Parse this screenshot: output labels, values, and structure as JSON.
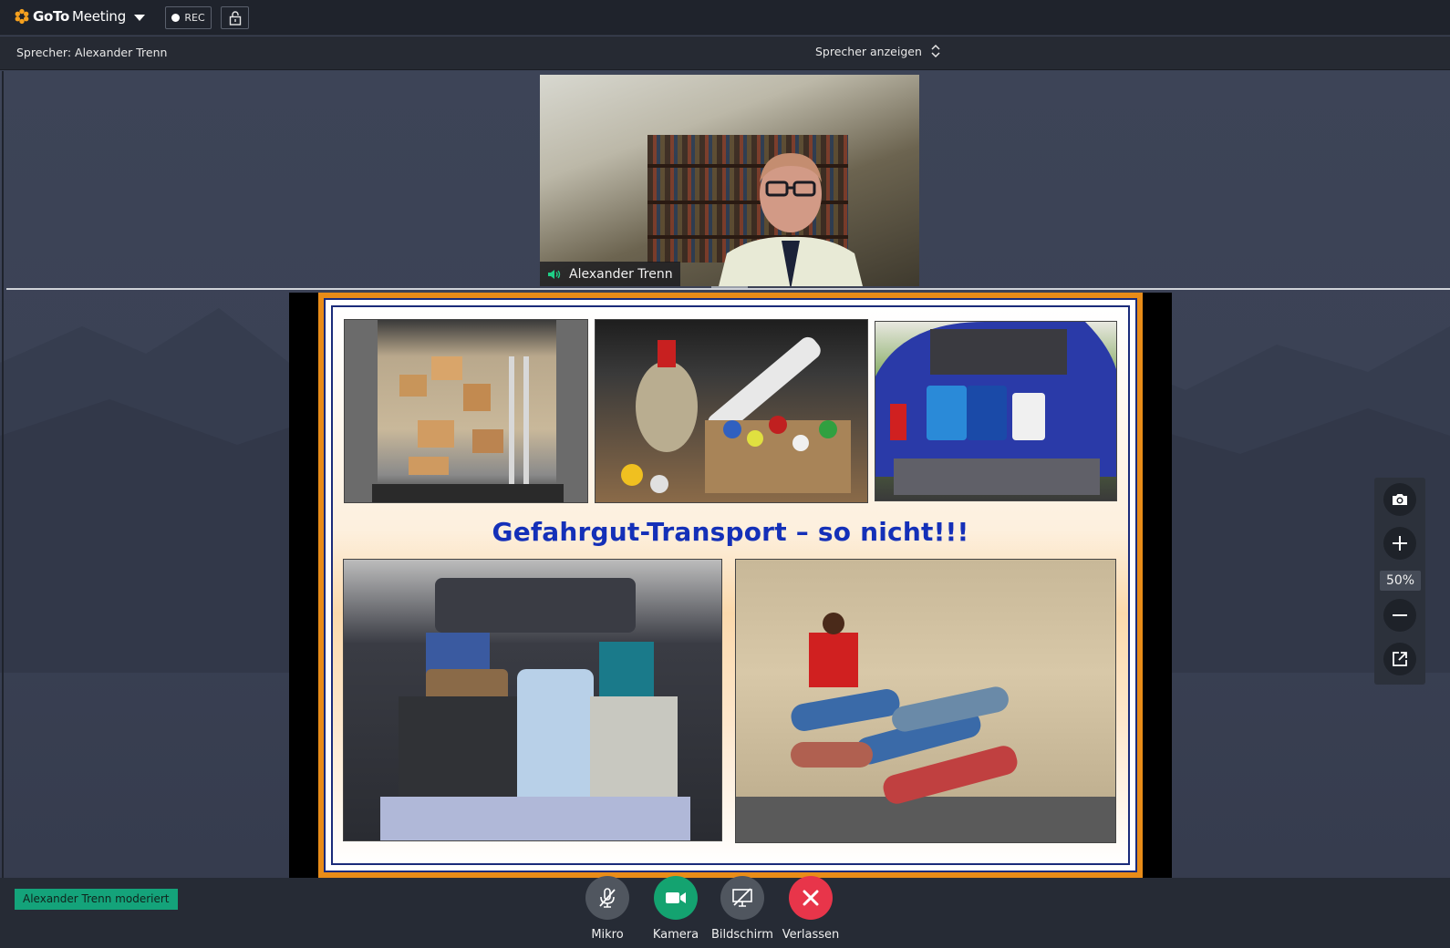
{
  "app": {
    "logo_goto": "GoTo",
    "logo_meeting": "Meeting",
    "rec_label": "REC"
  },
  "speakerbar": {
    "speaker_text": "Sprecher: Alexander Trenn",
    "view_label": "Sprecher anzeigen"
  },
  "webcam": {
    "name": "Alexander Trenn"
  },
  "slide": {
    "title": "Gefahrgut-Transport – so nicht!!!"
  },
  "zoom": {
    "level": "50%"
  },
  "bottom": {
    "moderator": "Alexander Trenn moderiert",
    "controls": {
      "mic": "Mikro",
      "camera": "Kamera",
      "screen": "Bildschirm",
      "leave": "Verlassen"
    }
  },
  "colors": {
    "accent_green": "#14a370",
    "leave_red": "#e8354a",
    "slide_title_blue": "#1430b8",
    "slide_orange": "#e98c18"
  }
}
